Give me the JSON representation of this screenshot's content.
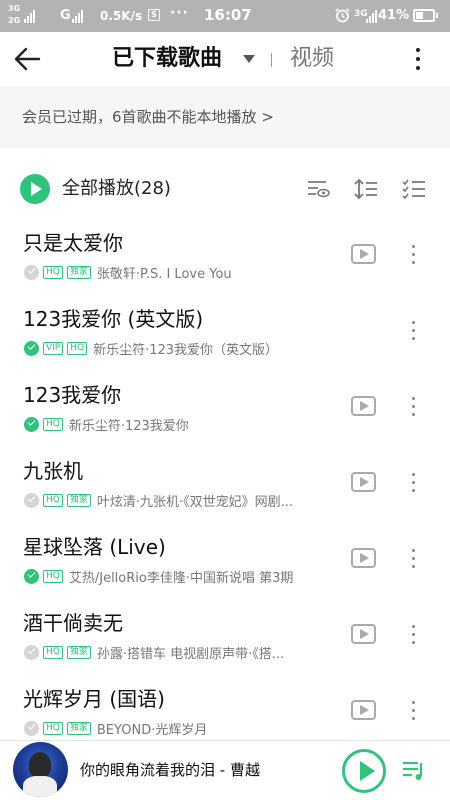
{
  "status_bar": {
    "net1": "3G",
    "net2": "2G",
    "net3": "G",
    "speed": "0.5K/s",
    "dots": "···",
    "time": "16:07",
    "net4": "3G",
    "battery": "41%"
  },
  "header": {
    "title": "已下载歌曲",
    "tab_video": "视频"
  },
  "notice": {
    "text": "会员已过期，6首歌曲不能本地播放 >"
  },
  "play_all": {
    "label": "全部播放(28)"
  },
  "colors": {
    "accent": "#31c27c",
    "status_bar": "#b3b3b3",
    "notice_bg": "#f6f6f6"
  },
  "songs": [
    {
      "title": "只是太爱你",
      "downloaded": false,
      "tags": [
        "HQ",
        "独家"
      ],
      "artist": "张敬轩·P.S. I Love You",
      "has_mv": true
    },
    {
      "title": "123我爱你 (英文版)",
      "downloaded": true,
      "tags": [
        "VIP",
        "HQ"
      ],
      "artist": "新乐尘符·123我爱你（英文版）",
      "has_mv": false
    },
    {
      "title": "123我爱你",
      "downloaded": true,
      "tags": [
        "HQ"
      ],
      "artist": "新乐尘符·123我爱你",
      "has_mv": true
    },
    {
      "title": "九张机",
      "downloaded": false,
      "tags": [
        "HQ",
        "独家"
      ],
      "artist": "叶炫清·九张机·《双世宠妃》网剧...",
      "has_mv": true
    },
    {
      "title": "星球坠落 (Live)",
      "downloaded": true,
      "tags": [
        "HQ"
      ],
      "artist": "艾热/JelloRio李佳隆·中国新说唱 第3期",
      "has_mv": true
    },
    {
      "title": "酒干倘卖无",
      "downloaded": false,
      "tags": [
        "HQ",
        "独家"
      ],
      "artist": "孙露·搭错车 电视剧原声带·《搭...",
      "has_mv": true
    },
    {
      "title": "光辉岁月 (国语)",
      "downloaded": false,
      "tags": [
        "HQ",
        "独家"
      ],
      "artist": "BEYOND·光辉岁月",
      "has_mv": true
    }
  ],
  "player": {
    "now_playing": "你的眼角流着我的泪 - 曹越"
  }
}
